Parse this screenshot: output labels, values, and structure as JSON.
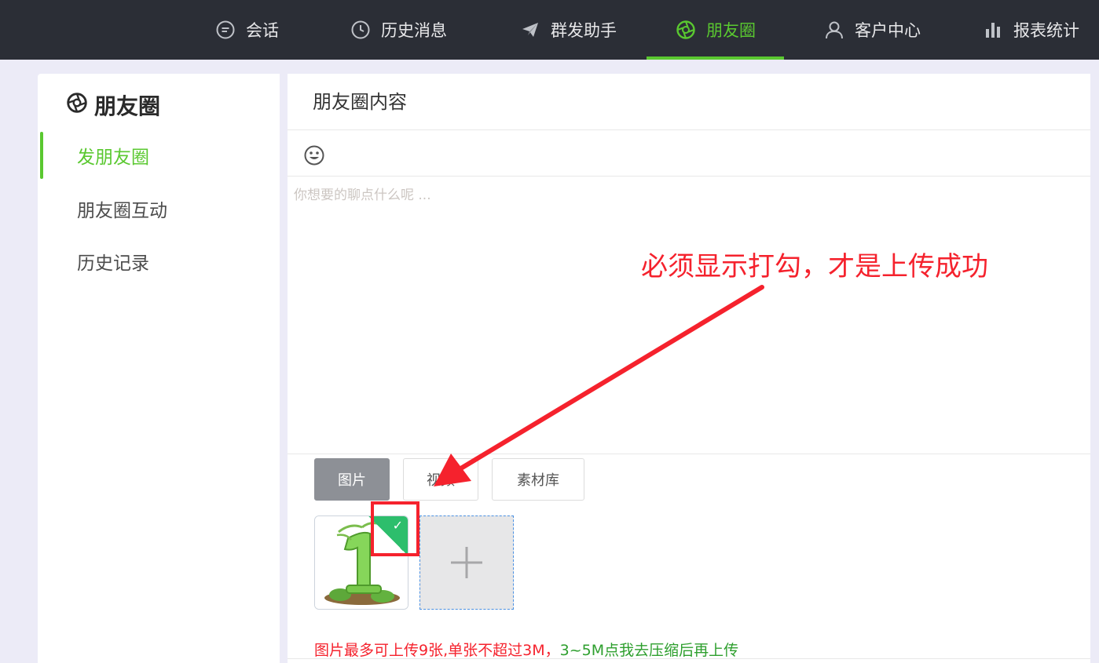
{
  "nav": {
    "items": [
      {
        "label": "会话",
        "icon": "chat-bubble-icon"
      },
      {
        "label": "历史消息",
        "icon": "clock-icon"
      },
      {
        "label": "群发助手",
        "icon": "paper-plane-icon"
      },
      {
        "label": "朋友圈",
        "icon": "aperture-icon",
        "active": true
      },
      {
        "label": "客户中心",
        "icon": "user-icon"
      },
      {
        "label": "报表统计",
        "icon": "bar-chart-icon"
      }
    ]
  },
  "sidebar": {
    "title": "朋友圈",
    "items": [
      {
        "label": "发朋友圈",
        "active": true
      },
      {
        "label": "朋友圈互动"
      },
      {
        "label": "历史记录"
      }
    ]
  },
  "main": {
    "title": "朋友圈内容",
    "placeholder": "你想要的聊点什么呢 ...",
    "tabs": [
      {
        "label": "图片",
        "active": true
      },
      {
        "label": "视频"
      },
      {
        "label": "素材库"
      }
    ],
    "note_red": "图片最多可上传9张,单张不超过3M，",
    "note_green": "3~5M点我去压缩后再上传"
  },
  "annotation": {
    "text": "必须显示打勾，才是上传成功"
  },
  "colors": {
    "accent": "#5ac830",
    "topbar": "#2b2e36",
    "annotation": "#f5222d",
    "upload_success": "#2dbe6c"
  }
}
